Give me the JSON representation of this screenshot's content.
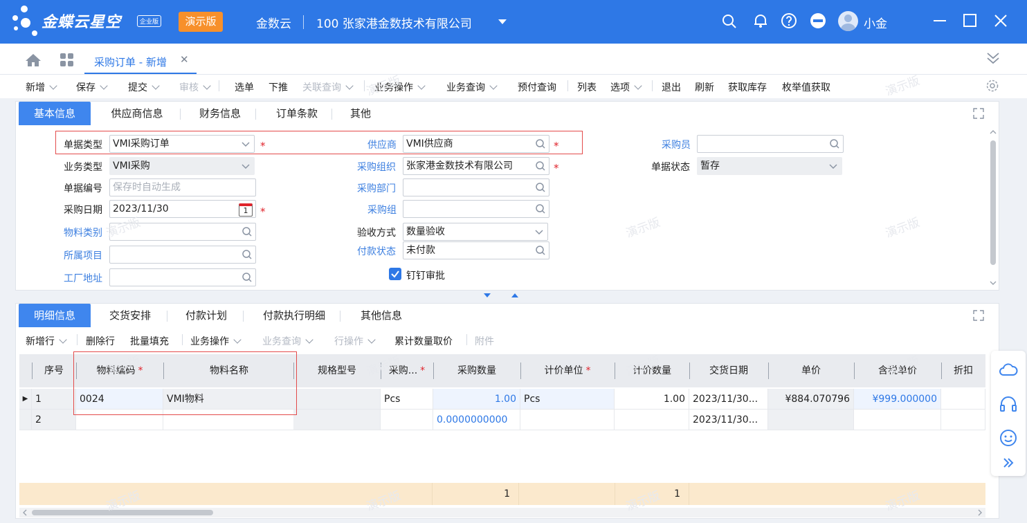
{
  "titlebar": {
    "brand": "金蝶云星空",
    "edition": "企业版",
    "demo_badge": "演示版",
    "org": "金数云",
    "company": "100  张家港金数技术有限公司",
    "user": "小金"
  },
  "tabs": {
    "active_label": "采购订单 - 新增"
  },
  "toolbar": [
    {
      "label": "新增",
      "caret": true,
      "disabled": false
    },
    {
      "label": "保存",
      "caret": true,
      "disabled": false
    },
    {
      "label": "提交",
      "caret": true,
      "disabled": false
    },
    {
      "label": "审核",
      "caret": true,
      "disabled": true
    },
    {
      "label": "选单",
      "caret": false,
      "disabled": false
    },
    {
      "label": "下推",
      "caret": false,
      "disabled": false
    },
    {
      "label": "关联查询",
      "caret": true,
      "disabled": true
    },
    {
      "label": "业务操作",
      "caret": true,
      "disabled": false
    },
    {
      "label": "业务查询",
      "caret": true,
      "disabled": false
    },
    {
      "label": "预付查询",
      "caret": false,
      "disabled": false
    },
    {
      "label": "列表",
      "caret": false,
      "disabled": false
    },
    {
      "label": "选项",
      "caret": true,
      "disabled": false
    },
    {
      "label": "退出",
      "caret": false,
      "disabled": false
    },
    {
      "label": "刷新",
      "caret": false,
      "disabled": false
    },
    {
      "label": "获取库存",
      "caret": false,
      "disabled": false
    },
    {
      "label": "枚举值获取",
      "caret": false,
      "disabled": false
    }
  ],
  "header_tabs": [
    "基本信息",
    "供应商信息",
    "财务信息",
    "订单条款",
    "其他"
  ],
  "form": {
    "bill_type": {
      "label": "单据类型",
      "value": "VMI采购订单"
    },
    "biz_type": {
      "label": "业务类型",
      "value": "VMI采购"
    },
    "bill_no": {
      "label": "单据编号",
      "placeholder": "保存时自动生成"
    },
    "purchase_date": {
      "label": "采购日期",
      "value": "2023/11/30",
      "calendar_day": "1"
    },
    "material_category": {
      "label": "物料类别",
      "value": ""
    },
    "project": {
      "label": "所属项目",
      "value": ""
    },
    "factory_address": {
      "label": "工厂地址",
      "value": ""
    },
    "supplier": {
      "label": "供应商",
      "value": "VMI供应商"
    },
    "purchase_org": {
      "label": "采购组织",
      "value": "张家港金数技术有限公司"
    },
    "purchase_dept": {
      "label": "采购部门",
      "value": ""
    },
    "purchase_group": {
      "label": "采购组",
      "value": ""
    },
    "acceptance_method": {
      "label": "验收方式",
      "value": "数量验收"
    },
    "payment_status": {
      "label": "付款状态",
      "value": "未付款"
    },
    "dingtalk": {
      "label": "钉钉审批",
      "checked": true
    },
    "buyer": {
      "label": "采购员",
      "value": ""
    },
    "bill_status": {
      "label": "单据状态",
      "value": "暂存"
    },
    "required_mark": "*"
  },
  "detail_tabs": [
    "明细信息",
    "交货安排",
    "付款计划",
    "付款执行明细",
    "其他信息"
  ],
  "detail_toolbar": [
    {
      "label": "新增行",
      "caret": true,
      "disabled": false
    },
    {
      "label": "删除行",
      "caret": false,
      "disabled": false
    },
    {
      "label": "批量填充",
      "caret": false,
      "disabled": false
    },
    {
      "label": "业务操作",
      "caret": true,
      "disabled": false
    },
    {
      "label": "业务查询",
      "caret": true,
      "disabled": true
    },
    {
      "label": "行操作",
      "caret": true,
      "disabled": true
    },
    {
      "label": "累计数量取价",
      "caret": false,
      "disabled": false
    },
    {
      "label": "附件",
      "caret": false,
      "disabled": true
    }
  ],
  "grid": {
    "columns": [
      {
        "label": "序号",
        "required": false
      },
      {
        "label": "物料编码",
        "required": true
      },
      {
        "label": "物料名称",
        "required": false
      },
      {
        "label": "规格型号",
        "required": false
      },
      {
        "label": "采购...",
        "required": true
      },
      {
        "label": "采购数量",
        "required": false
      },
      {
        "label": "计价单位",
        "required": true
      },
      {
        "label": "计价数量",
        "required": false
      },
      {
        "label": "交货日期",
        "required": false
      },
      {
        "label": "单价",
        "required": false
      },
      {
        "label": "含税单价",
        "required": false
      },
      {
        "label": "折扣",
        "required": false
      }
    ],
    "rows": [
      [
        "1",
        "0024",
        "VMI物料",
        "",
        "Pcs",
        "1.00",
        "Pcs",
        "1.00",
        "2023/11/30...",
        "¥884.070796",
        "¥999.000000",
        ""
      ],
      [
        "2",
        "",
        "",
        "",
        "",
        "0.0000000000",
        "",
        "",
        "2023/11/30...",
        "",
        "",
        ""
      ]
    ],
    "totals": {
      "purchase_qty": "1",
      "price_qty": "1"
    }
  },
  "watermark_text": "演示版",
  "colors": {
    "brand_blue": "#2e78e6",
    "demo_orange": "#f7902b",
    "required_red": "#e0242c",
    "link_blue": "#3c7fe0",
    "footer_beige": "#fbe9cd"
  }
}
